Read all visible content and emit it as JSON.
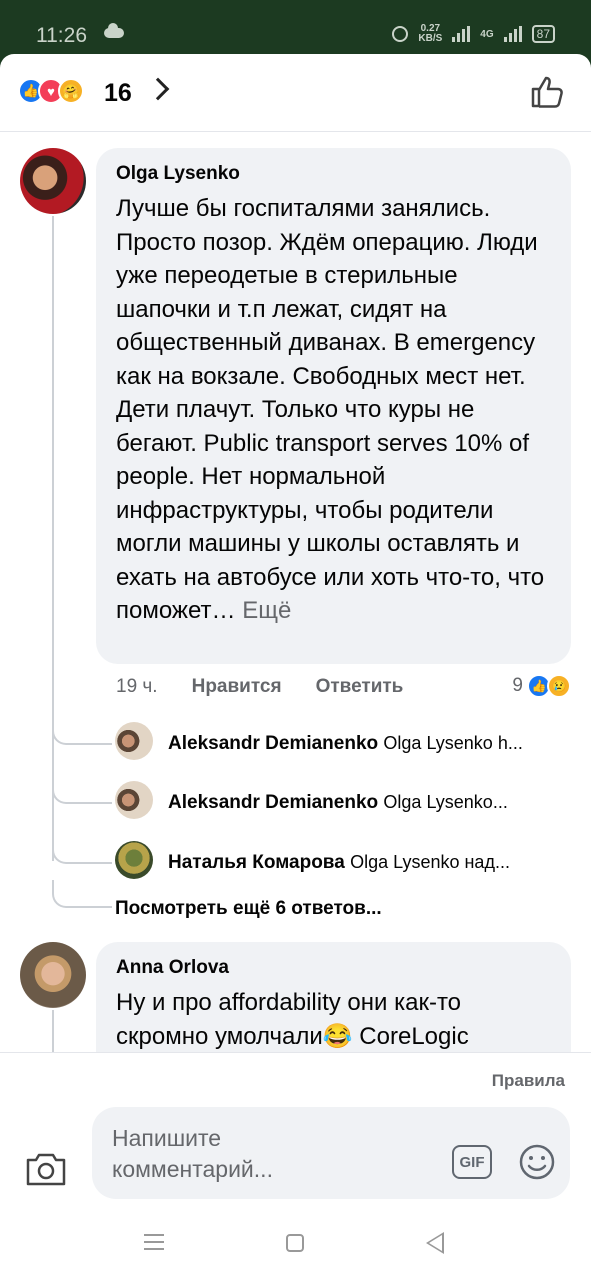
{
  "status_bar": {
    "time": "11:26",
    "net_speed_value": "0.27",
    "net_speed_unit": "KB/S",
    "network_label": "4G",
    "battery": "87"
  },
  "reactions": {
    "count": "16",
    "icons": [
      "like-icon",
      "love-icon",
      "care-icon"
    ]
  },
  "comments": [
    {
      "author": "Olga Lysenko",
      "text": "Лучше бы госпиталями занялись. Просто позор. Ждём операцию. Люди уже переодетые в стерильные шапочки и т.п лежат, сидят на общественный диванах. В emergency как на вокзале. Свободных мест нет. Дети плачут. Только что куры не бегают. Public transport serves 10% of people. Нет нормальной инфраструктуры, чтобы родители могли машины у школы оставлять и ехать на автобусе или хоть что-то,  что поможет…",
      "more": "Ещё",
      "time": "19 ч.",
      "like_action": "Нравится",
      "reply_action": "Ответить",
      "reaction_count": "9"
    },
    {
      "author": "Anna Orlova",
      "text": "Ну и про affordability они как-то скромно умолчали😂 CoreLogic"
    }
  ],
  "replies": [
    {
      "author": "Aleksandr Demianenko",
      "preview": "Olga Lysenko h..."
    },
    {
      "author": "Aleksandr Demianenko",
      "preview": "Olga Lysenko..."
    },
    {
      "author": "Наталья Комарова",
      "preview": "Olga Lysenko над..."
    }
  ],
  "more_replies": "Посмотреть ещё 6 ответов...",
  "composer": {
    "rules": "Правила",
    "placeholder": "Напишите комментарий...",
    "gif_label": "GIF"
  },
  "colors": {
    "accent": "#1877f2",
    "bubble": "#f0f2f5",
    "secondary_text": "#65676b",
    "status_bar": "#1c3a21"
  }
}
